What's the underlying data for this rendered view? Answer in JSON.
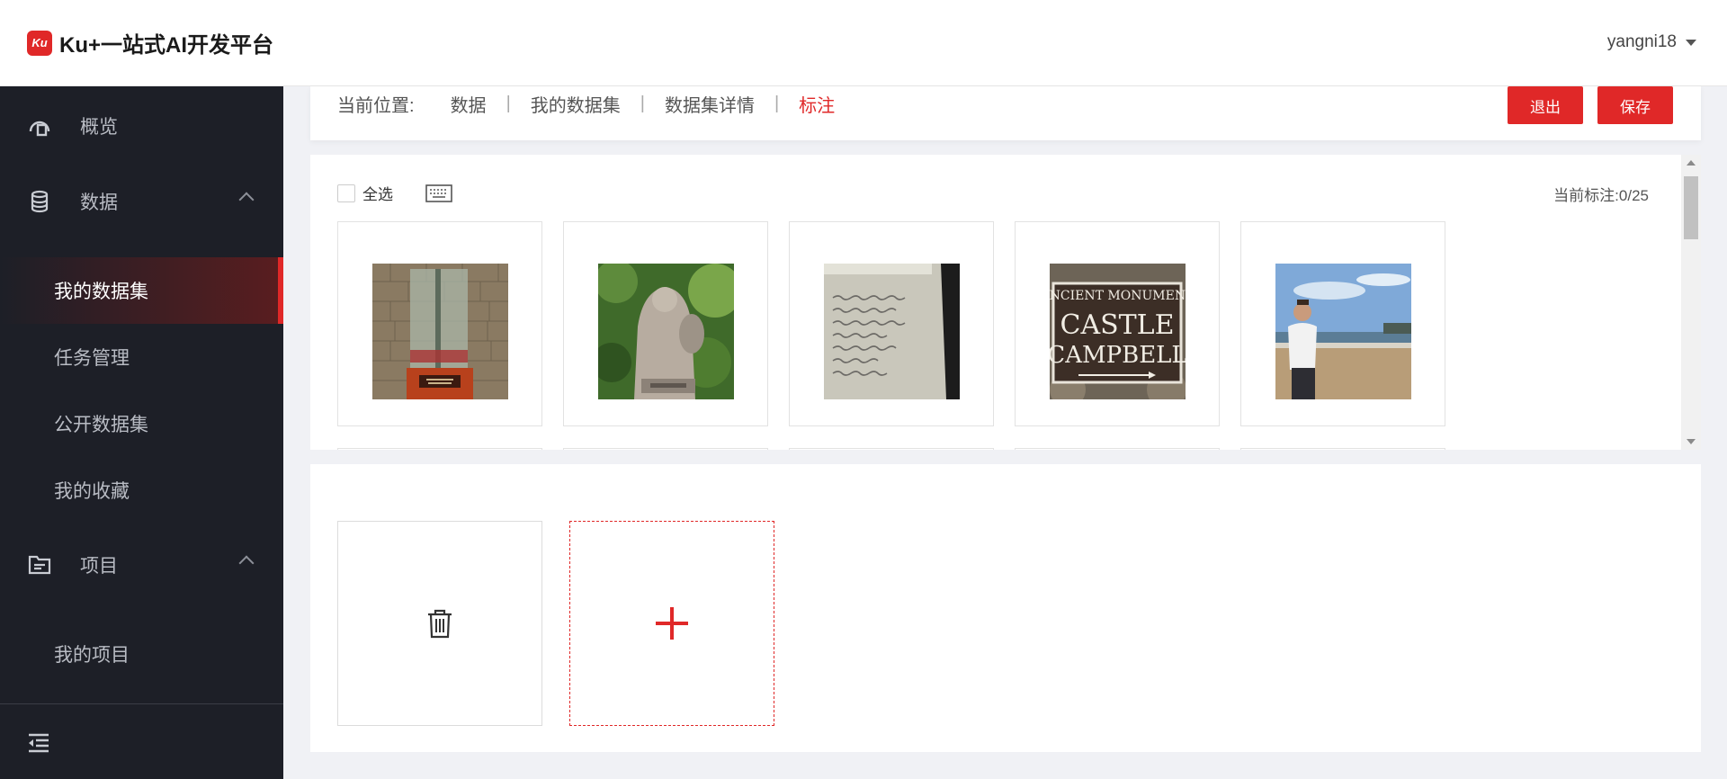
{
  "header": {
    "logo_icon": "ku-logo-icon",
    "logo_mark_text": "Ku",
    "app_title": "Ku+一站式AI开发平台",
    "username": "yangni18"
  },
  "sidebar": {
    "groups": [
      {
        "label": "概览",
        "icon": "dashboard-icon"
      },
      {
        "label": "数据",
        "icon": "database-icon",
        "expanded": true
      },
      {
        "label": "项目",
        "icon": "folder-icon",
        "expanded": true
      }
    ],
    "items": [
      {
        "label": "我的数据集",
        "active": true
      },
      {
        "label": "任务管理"
      },
      {
        "label": "公开数据集"
      },
      {
        "label": "我的收藏"
      },
      {
        "label": "我的项目"
      }
    ],
    "collapse_icon": "menu-collapse-icon"
  },
  "breadcrumb": {
    "prefix": "当前位置:",
    "items": [
      "数据",
      "我的数据集",
      "数据集详情"
    ],
    "current": "标注"
  },
  "actions": {
    "exit_label": "退出",
    "save_label": "保存"
  },
  "gallery": {
    "select_all_label": "全选",
    "select_all_checked": false,
    "keyboard_icon": "keyboard-icon",
    "counter_label": "当前标注:",
    "counter_value": "0/25",
    "thumbnails": [
      {
        "subject": "glass monument in stone room"
      },
      {
        "subject": "stone statue with shield"
      },
      {
        "subject": "handwritten note on paper"
      },
      {
        "subject": "ancient monument sign",
        "line1": "ANCIENT MONUMENT",
        "line2": "CASTLE",
        "line3": "CAMPBELL"
      },
      {
        "subject": "man standing on beach"
      }
    ]
  },
  "labels": {
    "delete_icon": "trash-icon",
    "add_icon": "plus-icon"
  },
  "colors": {
    "accent": "#e02828",
    "sidebar_bg": "#1d1f27",
    "page_bg": "#f0f1f5"
  }
}
